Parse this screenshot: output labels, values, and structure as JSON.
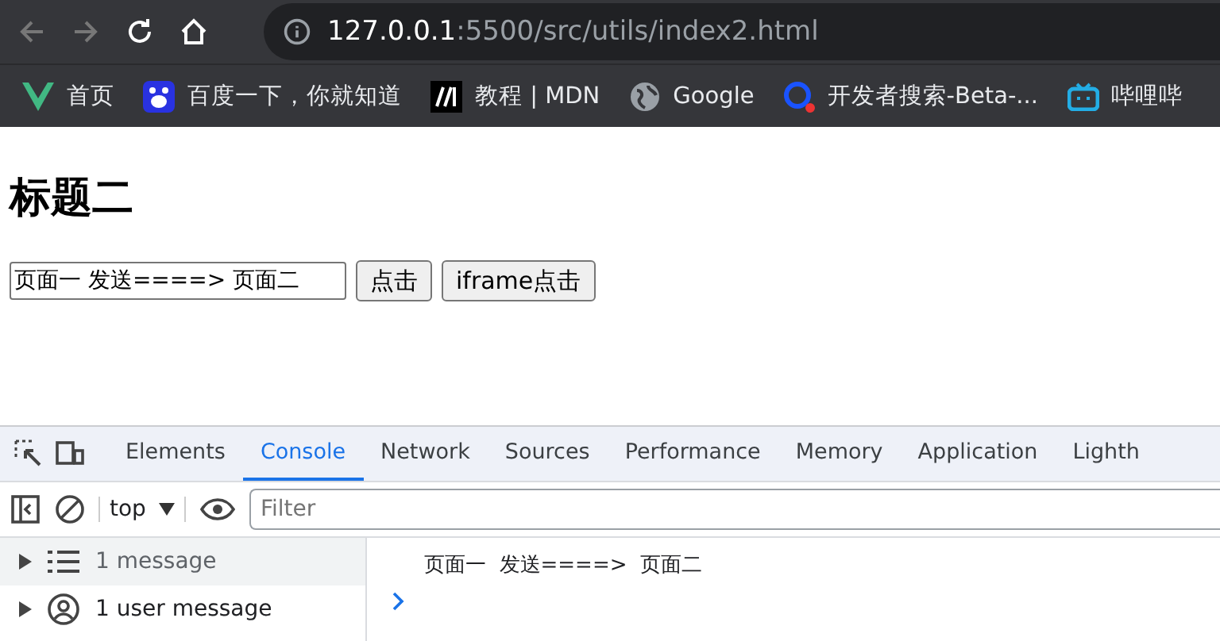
{
  "browser": {
    "url_host": "127.0.0.1",
    "url_path": ":5500/src/utils/index2.html",
    "bookmarks": [
      {
        "kind": "vue",
        "label": "首页"
      },
      {
        "kind": "paw",
        "label": "百度一下，你就知道"
      },
      {
        "kind": "mdn",
        "label": "教程 | MDN"
      },
      {
        "kind": "globe",
        "label": "Google"
      },
      {
        "kind": "search",
        "label": "开发者搜索-Beta-..."
      },
      {
        "kind": "tv",
        "label": "哔哩哔"
      }
    ]
  },
  "page": {
    "heading": "标题二",
    "input_value": "页面一 发送====> 页面二",
    "buttons": [
      "点击",
      "iframe点击"
    ]
  },
  "devtools": {
    "tabs": [
      {
        "label": "Elements",
        "selected": false
      },
      {
        "label": "Console",
        "selected": true
      },
      {
        "label": "Network",
        "selected": false
      },
      {
        "label": "Sources",
        "selected": false
      },
      {
        "label": "Performance",
        "selected": false
      },
      {
        "label": "Memory",
        "selected": false
      },
      {
        "label": "Application",
        "selected": false
      },
      {
        "label": "Lighth",
        "selected": false
      }
    ],
    "context": "top",
    "filter_placeholder": "Filter",
    "sidebar": [
      {
        "kind": "list",
        "label": "1 message",
        "selected": true
      },
      {
        "kind": "user",
        "label": "1 user message",
        "selected": false
      }
    ],
    "log": [
      "页面一  发送====>  页面二"
    ]
  }
}
